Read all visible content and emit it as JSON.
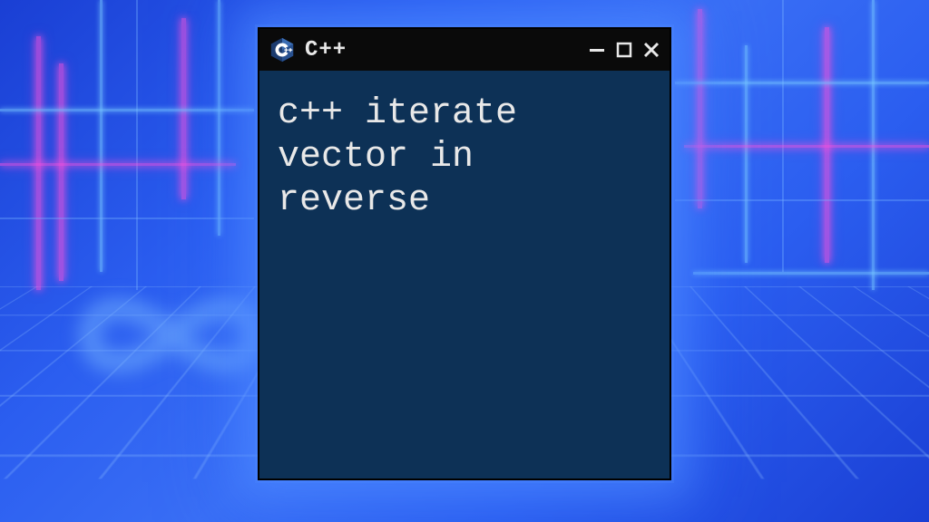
{
  "window": {
    "title": "C++",
    "logo_name": "cpp-logo"
  },
  "content": {
    "text": "c++ iterate\nvector in\nreverse"
  }
}
